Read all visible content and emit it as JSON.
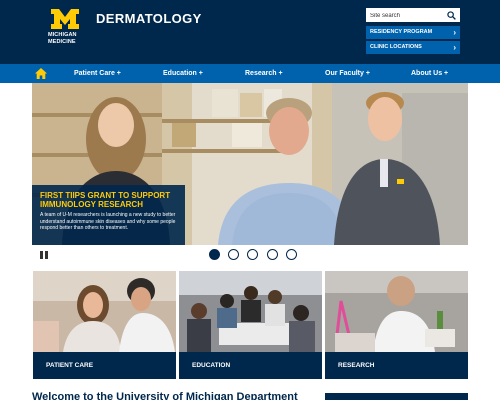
{
  "header": {
    "logo": {
      "line1": "MICHIGAN",
      "line2": "MEDICINE",
      "brand_color": "#00274c",
      "accent_color": "#ffcb05"
    },
    "department": "DERMATOLOGY",
    "search": {
      "placeholder": "Site search",
      "icon": "search-icon"
    },
    "quick_links": [
      {
        "label": "RESIDENCY PROGRAM",
        "icon": "chevron-right-icon"
      },
      {
        "label": "CLINIC LOCATIONS",
        "icon": "chevron-right-icon"
      }
    ]
  },
  "nav": {
    "home_icon": "home-icon",
    "items": [
      {
        "label": "Patient Care +"
      },
      {
        "label": "Education +"
      },
      {
        "label": "Research +"
      },
      {
        "label": "Our Faculty +"
      },
      {
        "label": "About Us +"
      }
    ],
    "color": "#0062ad"
  },
  "hero": {
    "title": "FIRST TIIPS GRANT TO SUPPORT IMMUNOLOGY RESEARCH",
    "text": "A team of U-M researchers is launching a new study to better understand autoimmune skin diseases and why some people respond better than others to treatment.",
    "slide_count": 5,
    "active_slide": 1,
    "pause_icon": "pause-icon"
  },
  "cards": [
    {
      "label": "PATIENT CARE"
    },
    {
      "label": "EDUCATION"
    },
    {
      "label": "RESEARCH"
    }
  ],
  "welcome": "Welcome to the University of Michigan Department"
}
